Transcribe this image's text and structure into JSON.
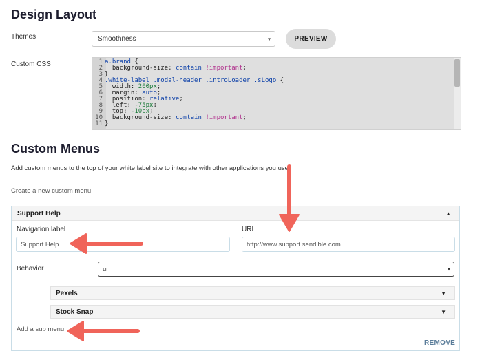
{
  "design_layout": {
    "title": "Design Layout",
    "themes_label": "Themes",
    "theme_value": "Smoothness",
    "preview_label": "PREVIEW",
    "custom_css_label": "Custom CSS",
    "code_lines": [
      {
        "n": "1",
        "text": "a.brand {"
      },
      {
        "n": "2",
        "text": "  background-size: contain !important;"
      },
      {
        "n": "3",
        "text": "}"
      },
      {
        "n": "4",
        "text": ".white-label .modal-header .introLoader .sLogo {"
      },
      {
        "n": "5",
        "text": "  width: 200px;"
      },
      {
        "n": "6",
        "text": "  margin: auto;"
      },
      {
        "n": "7",
        "text": "  position: relative;"
      },
      {
        "n": "8",
        "text": "  left: -75px;"
      },
      {
        "n": "9",
        "text": "  top: -10px;"
      },
      {
        "n": "10",
        "text": "  background-size: contain !important;"
      },
      {
        "n": "11",
        "text": "}"
      }
    ]
  },
  "custom_menus": {
    "title": "Custom Menus",
    "description": "Add custom menus to the top of your white label site to integrate with other applications you use.",
    "create_link": "Create a new custom menu",
    "menu": {
      "title": "Support Help",
      "nav_label_caption": "Navigation label",
      "nav_label_value": "Support Help",
      "url_caption": "URL",
      "url_value": "http://www.support.sendible.com",
      "behavior_caption": "Behavior",
      "behavior_value": "url",
      "sub_menus": [
        {
          "label": "Pexels"
        },
        {
          "label": "Stock Snap"
        }
      ],
      "add_sub_menu": "Add a sub menu",
      "remove_label": "REMOVE"
    }
  },
  "colors": {
    "annotation_arrow": "#f0645a",
    "remove_link": "#5a7c99",
    "panel_border": "#c9dde7"
  }
}
